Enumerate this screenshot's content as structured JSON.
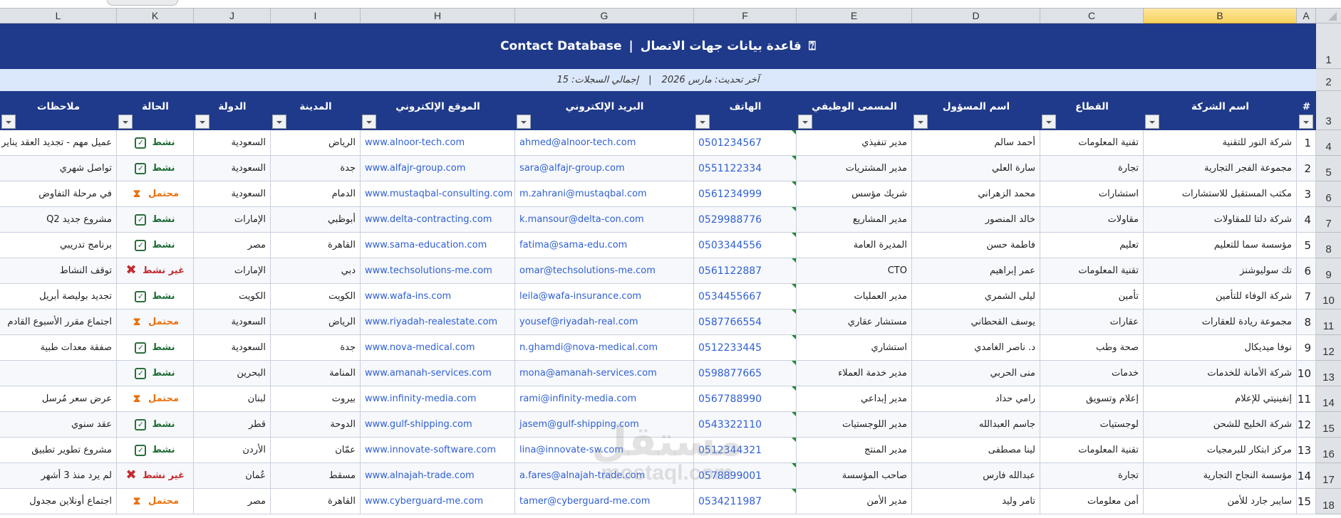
{
  "column_letters": [
    "A",
    "B",
    "C",
    "D",
    "E",
    "F",
    "G",
    "H",
    "I",
    "J",
    "K",
    "L"
  ],
  "selected_column": "B",
  "title": {
    "en": "Contact Database",
    "separator": "|",
    "ar": "قاعدة بيانات جهات الاتصال",
    "icon": "⍰"
  },
  "subtitle": {
    "updated": "آخر تحديث: مارس 2026",
    "separator": "|",
    "total": "إجمالي السجلات: 15"
  },
  "headers": {
    "num": "#",
    "company": "اسم الشركة",
    "sector": "القطاع",
    "contact": "اسم المسؤول",
    "job": "المسمى الوظيفي",
    "phone": "الهاتف",
    "email": "البريد الإلكتروني",
    "website": "الموقع الإلكتروني",
    "city": "المدينة",
    "country": "الدولة",
    "status": "الحالة",
    "notes": "ملاحظات"
  },
  "status_labels": {
    "active": "نشط",
    "pending": "محتمل",
    "inactive": "غير نشط"
  },
  "colors": {
    "header_bg": "#1f3a8a",
    "subtitle_bg": "#dbe8fb",
    "link": "#2f5fd3",
    "active_bg": "#dcfae6",
    "pending_bg": "#fff1c6",
    "inactive_bg": "#fde0e6"
  },
  "rows": [
    {
      "num": "1",
      "company": "شركة النور للتقنية",
      "sector": "تقنية المعلومات",
      "contact": "أحمد سالم",
      "job": "مدير تنفيذي",
      "phone": "0501234567",
      "email": "ahmed@alnoor-tech.com",
      "website": "www.alnoor-tech.com",
      "city": "الرياض",
      "country": "السعودية",
      "status": "active",
      "notes": "عميل مهم - تجديد العقد يناير"
    },
    {
      "num": "2",
      "company": "مجموعة الفجر التجارية",
      "sector": "تجارة",
      "contact": "سارة العلي",
      "job": "مدير المشتريات",
      "phone": "0551122334",
      "email": "sara@alfajr-group.com",
      "website": "www.alfajr-group.com",
      "city": "جدة",
      "country": "السعودية",
      "status": "active",
      "notes": "تواصل شهري"
    },
    {
      "num": "3",
      "company": "مكتب المستقبل للاستشارات",
      "sector": "استشارات",
      "contact": "محمد الزهراني",
      "job": "شريك مؤسس",
      "phone": "0561234999",
      "email": "m.zahrani@mustaqbal.com",
      "website": "www.mustaqbal-consulting.com",
      "city": "الدمام",
      "country": "السعودية",
      "status": "pending",
      "notes": "في مرحلة التفاوض"
    },
    {
      "num": "4",
      "company": "شركة دلتا للمقاولات",
      "sector": "مقاولات",
      "contact": "خالد المنصور",
      "job": "مدير المشاريع",
      "phone": "0529988776",
      "email": "k.mansour@delta-con.com",
      "website": "www.delta-contracting.com",
      "city": "أبوظبي",
      "country": "الإمارات",
      "status": "active",
      "notes": "مشروع جديد Q2"
    },
    {
      "num": "5",
      "company": "مؤسسة سما للتعليم",
      "sector": "تعليم",
      "contact": "فاطمة حسن",
      "job": "المديرة العامة",
      "phone": "0503344556",
      "email": "fatima@sama-edu.com",
      "website": "www.sama-education.com",
      "city": "القاهرة",
      "country": "مصر",
      "status": "active",
      "notes": "برنامج تدريبي"
    },
    {
      "num": "6",
      "company": "تك سوليوشنز",
      "sector": "تقنية المعلومات",
      "contact": "عمر إبراهيم",
      "job": "CTO",
      "phone": "0561122887",
      "email": "omar@techsolutions-me.com",
      "website": "www.techsolutions-me.com",
      "city": "دبي",
      "country": "الإمارات",
      "status": "inactive",
      "notes": "توقف النشاط"
    },
    {
      "num": "7",
      "company": "شركة الوفاء للتأمين",
      "sector": "تأمين",
      "contact": "ليلى الشمري",
      "job": "مدير العمليات",
      "phone": "0534455667",
      "email": "leila@wafa-insurance.com",
      "website": "www.wafa-ins.com",
      "city": "الكويت",
      "country": "الكويت",
      "status": "active",
      "notes": "تجديد بوليصة أبريل"
    },
    {
      "num": "8",
      "company": "مجموعة ريادة للعقارات",
      "sector": "عقارات",
      "contact": "يوسف القحطاني",
      "job": "مستشار عقاري",
      "phone": "0587766554",
      "email": "yousef@riyadah-real.com",
      "website": "www.riyadah-realestate.com",
      "city": "الرياض",
      "country": "السعودية",
      "status": "pending",
      "notes": "اجتماع مقرر الأسبوع القادم"
    },
    {
      "num": "9",
      "company": "نوفا ميديكال",
      "sector": "صحة وطب",
      "contact": "د. ناصر الغامدي",
      "job": "استشاري",
      "phone": "0512233445",
      "email": "n.ghamdi@nova-medical.com",
      "website": "www.nova-medical.com",
      "city": "جدة",
      "country": "السعودية",
      "status": "active",
      "notes": "صفقة معدات طبية"
    },
    {
      "num": "10",
      "company": "شركة الأمانة للخدمات",
      "sector": "خدمات",
      "contact": "منى الحربي",
      "job": "مدير خدمة العملاء",
      "phone": "0598877665",
      "email": "mona@amanah-services.com",
      "website": "www.amanah-services.com",
      "city": "المنامة",
      "country": "البحرين",
      "status": "active",
      "notes": ""
    },
    {
      "num": "11",
      "company": "إنفينيتي للإعلام",
      "sector": "إعلام وتسويق",
      "contact": "رامي حداد",
      "job": "مدير إبداعي",
      "phone": "0567788990",
      "email": "rami@infinity-media.com",
      "website": "www.infinity-media.com",
      "city": "بيروت",
      "country": "لبنان",
      "status": "pending",
      "notes": "عرض سعر مُرسل"
    },
    {
      "num": "12",
      "company": "شركة الخليج للشحن",
      "sector": "لوجستيات",
      "contact": "جاسم العبدالله",
      "job": "مدير اللوجستيات",
      "phone": "0543322110",
      "email": "jasem@gulf-shipping.com",
      "website": "www.gulf-shipping.com",
      "city": "الدوحة",
      "country": "قطر",
      "status": "active",
      "notes": "عقد سنوي"
    },
    {
      "num": "13",
      "company": "مركز ابتكار للبرمجيات",
      "sector": "تقنية المعلومات",
      "contact": "لينا مصطفى",
      "job": "مدير المنتج",
      "phone": "0512344321",
      "email": "lina@innovate-sw.com",
      "website": "www.innovate-software.com",
      "city": "عمّان",
      "country": "الأردن",
      "status": "active",
      "notes": "مشروع تطوير تطبيق"
    },
    {
      "num": "14",
      "company": "مؤسسة النجاح التجارية",
      "sector": "تجارة",
      "contact": "عبدالله فارس",
      "job": "صاحب المؤسسة",
      "phone": "0578899001",
      "email": "a.fares@alnajah-trade.com",
      "website": "www.alnajah-trade.com",
      "city": "مسقط",
      "country": "عُمان",
      "status": "inactive",
      "notes": "لم يرد منذ 3 أشهر"
    },
    {
      "num": "15",
      "company": "سايبر جارد للأمن",
      "sector": "أمن معلومات",
      "contact": "تامر وليد",
      "job": "مدير الأمن",
      "phone": "0534211987",
      "email": "tamer@cyberguard-me.com",
      "website": "www.cyberguard-me.com",
      "city": "القاهرة",
      "country": "مصر",
      "status": "pending",
      "notes": "اجتماع أونلاين مجدول"
    }
  ],
  "row_numbers": [
    "1",
    "2",
    "3",
    "4",
    "5",
    "6",
    "7",
    "8",
    "9",
    "10",
    "11",
    "12",
    "13",
    "14",
    "15",
    "16",
    "17",
    "18"
  ],
  "watermark": {
    "ar": "مستقل",
    "en": "mostaql.com"
  }
}
